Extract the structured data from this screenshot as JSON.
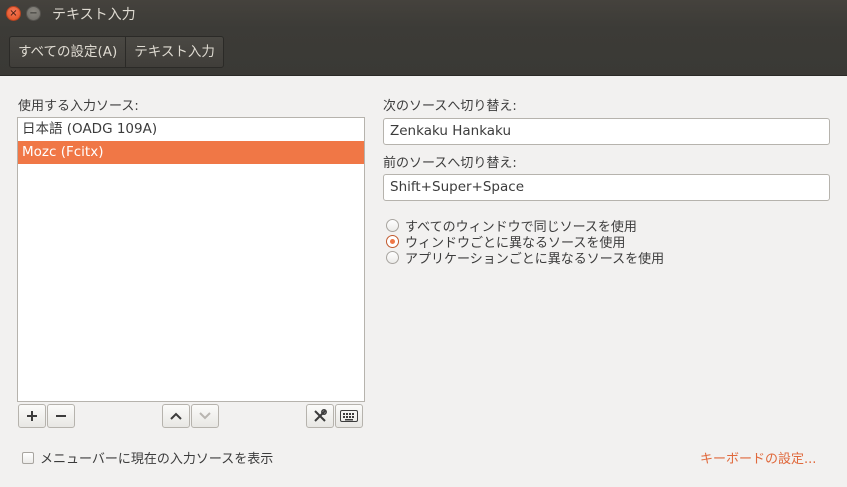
{
  "window": {
    "title": "テキスト入力",
    "close_glyph": "×",
    "minimize_glyph": "−"
  },
  "breadcrumbs": [
    "すべての設定(A)",
    "テキスト入力"
  ],
  "sources": {
    "label": "使用する入力ソース:",
    "items": [
      {
        "label": "日本語 (OADG 109A)",
        "selected": false
      },
      {
        "label": "Mozc (Fcitx)",
        "selected": true
      }
    ]
  },
  "next_source": {
    "label": "次のソースへ切り替え:",
    "value": "Zenkaku Hankaku"
  },
  "prev_source": {
    "label": "前のソースへ切り替え:",
    "value": "Shift+Super+Space"
  },
  "source_mode": {
    "options": [
      {
        "label": "すべてのウィンドウで同じソースを使用",
        "checked": false
      },
      {
        "label": "ウィンドウごとに異なるソースを使用",
        "checked": true
      },
      {
        "label": "アプリケーションごとに異なるソースを使用",
        "checked": false
      }
    ]
  },
  "show_in_menubar": {
    "label": "メニューバーに現在の入力ソースを表示",
    "checked": false
  },
  "keyboard_settings_link": "キーボードの設定...",
  "colors": {
    "accent": "#f07746",
    "link": "#e0693c",
    "titlebar": "#3c3b37"
  }
}
